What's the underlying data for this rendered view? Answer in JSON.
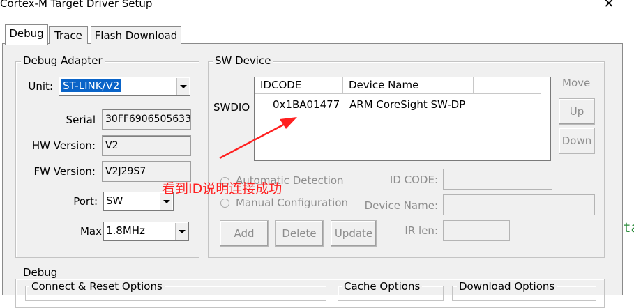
{
  "window": {
    "title": "Cortex-M Target Driver Setup",
    "close_glyph": "✕"
  },
  "tabs": [
    {
      "label": "Debug",
      "active": true
    },
    {
      "label": "Trace",
      "active": false
    },
    {
      "label": "Flash Download",
      "active": false
    }
  ],
  "debug_adapter": {
    "group_label": "Debug Adapter",
    "unit_label": "Unit:",
    "unit_value": "ST-LINK/V2",
    "serial_label": "Serial",
    "serial_value": "30FF6906505633",
    "hw_label": "HW Version:",
    "hw_value": "V2",
    "fw_label": "FW Version:",
    "fw_value": "V2J29S7",
    "port_label": "Port:",
    "port_value": "SW",
    "max_label": "Max",
    "max_value": "1.8MHz"
  },
  "sw_device": {
    "group_label": "SW Device",
    "swdio_label": "SWDIO",
    "columns": [
      "IDCODE",
      "Device Name"
    ],
    "rows": [
      {
        "idcode": "0x1BA01477",
        "device_name": "ARM CoreSight SW-DP"
      }
    ],
    "move_label": "Move",
    "up_label": "Up",
    "down_label": "Down",
    "auto_detection_label": "Automatic Detection",
    "manual_config_label": "Manual Configuration",
    "id_code_label": "ID CODE:",
    "device_name_label": "Device Name:",
    "ir_len_label": "IR len:",
    "add_label": "Add",
    "delete_label": "Delete",
    "update_label": "Update"
  },
  "debug_section": {
    "group_label": "Debug",
    "connect_reset_label": "Connect & Reset Options",
    "cache_label": "Cache Options",
    "download_label": "Download Options"
  },
  "annotation": {
    "text": "看到ID说明连接成功",
    "color": "#ff2020"
  },
  "background_text": "ta"
}
